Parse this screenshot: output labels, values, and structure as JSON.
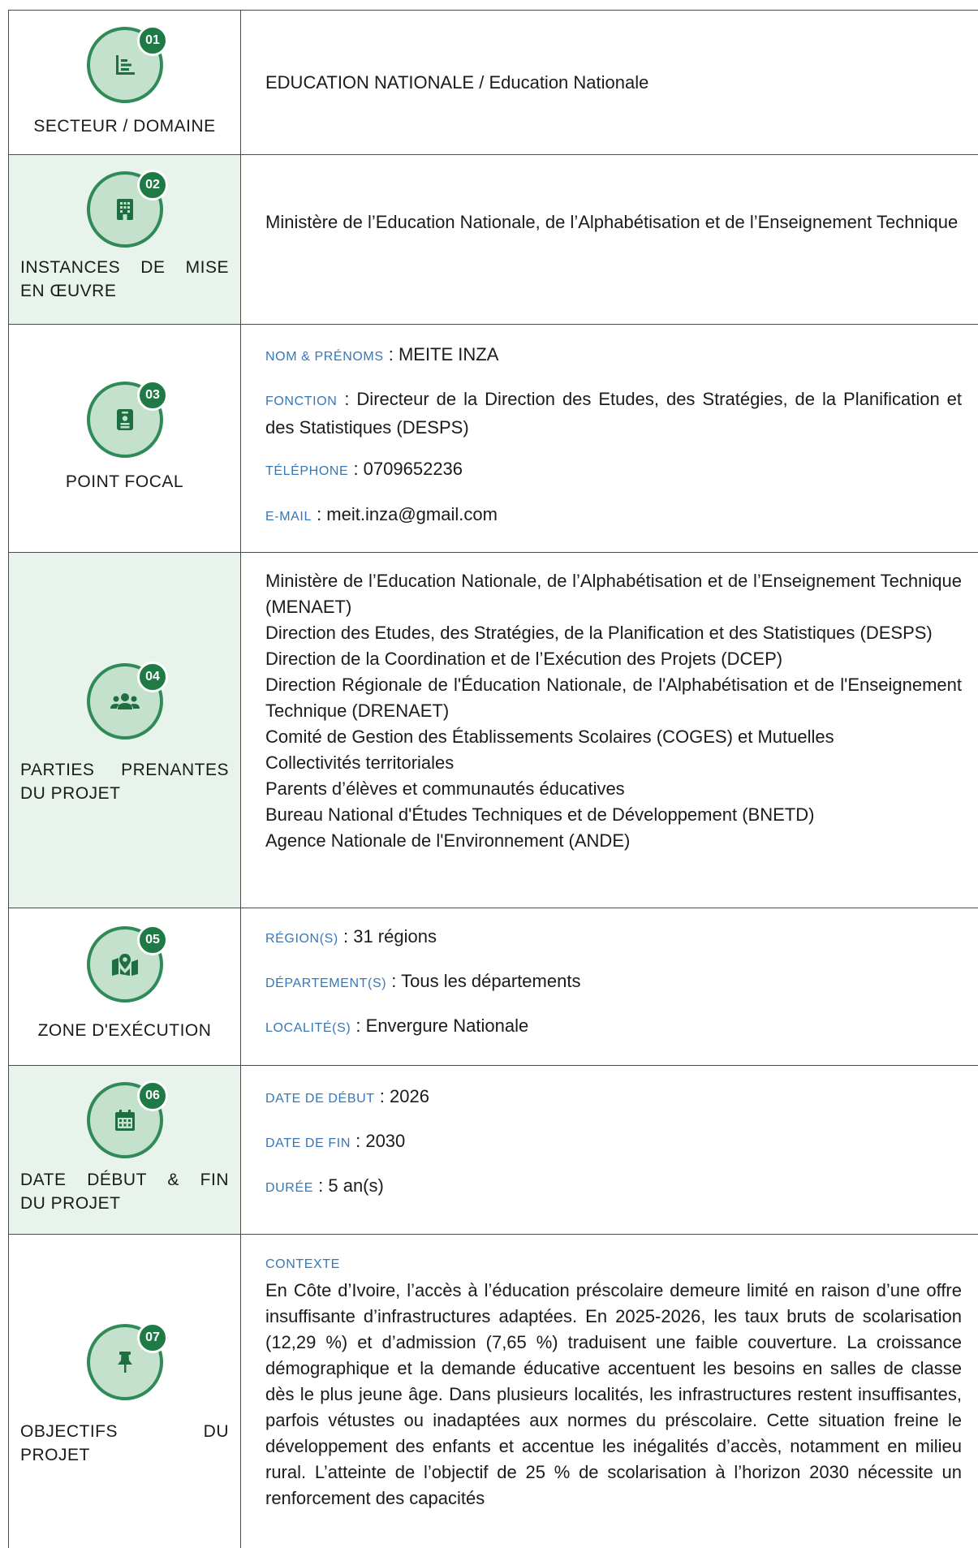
{
  "rows": [
    {
      "number": "01",
      "icon": "list-chart-icon",
      "label": "SECTEUR / DOMAINE",
      "value": "EDUCATION NATIONALE / Education Nationale"
    },
    {
      "number": "02",
      "icon": "building-icon",
      "label_line1": "INSTANCES DE MISE",
      "label_line2": "EN ŒUVRE",
      "value": "Ministère de l’Education Nationale, de l’Alphabétisation et de l’Enseignement Technique"
    },
    {
      "number": "03",
      "icon": "id-badge-icon",
      "label": "POINT FOCAL",
      "fields": [
        {
          "key": "NOM & PRÉNOMS",
          "value": "MEITE INZA"
        },
        {
          "key": "FONCTION",
          "value": "Directeur de la Direction des Etudes, des Stratégies, de la Planification et des Statistiques (DESPS)"
        },
        {
          "key": "TÉLÉPHONE",
          "value": "0709652236"
        },
        {
          "key": "E-MAIL",
          "value": "meit.inza@gmail.com"
        }
      ]
    },
    {
      "number": "04",
      "icon": "users-icon",
      "label_line1": "PARTIES PRENANTES",
      "label_line2": "DU PROJET",
      "stakeholders": [
        "Ministère de l’Education Nationale, de l’Alphabétisation et de l’Enseignement Technique (MENAET)",
        "Direction des Etudes, des Stratégies, de la Planification et des Statistiques (DESPS)",
        "Direction de la Coordination et de l’Exécution des Projets (DCEP)",
        "Direction Régionale de l'Éducation Nationale, de l'Alphabétisation et de l'Enseignement Technique (DRENAET)",
        "Comité de Gestion des Établissements Scolaires (COGES) et Mutuelles",
        "Collectivités territoriales",
        "Parents d’élèves et communautés éducatives",
        "Bureau National d'Études Techniques et de Développement (BNETD)",
        "Agence Nationale de l'Environnement (ANDE)"
      ]
    },
    {
      "number": "05",
      "icon": "map-pin-icon",
      "label": "ZONE D'EXÉCUTION",
      "fields": [
        {
          "key": "RÉGION(S)",
          "value": "31 régions"
        },
        {
          "key": "DÉPARTEMENT(S)",
          "value": "Tous les départements"
        },
        {
          "key": "LOCALITÉ(S)",
          "value": "Envergure Nationale"
        }
      ]
    },
    {
      "number": "06",
      "icon": "calendar-icon",
      "label_line1": "DATE DÉBUT & FIN",
      "label_line2": "DU PROJET",
      "fields": [
        {
          "key": "DATE DE DÉBUT",
          "value": "2026"
        },
        {
          "key": "DATE DE FIN",
          "value": "2030"
        },
        {
          "key": "DURÉE",
          "value": "5 an(s)"
        }
      ]
    },
    {
      "number": "07",
      "icon": "pushpin-icon",
      "label_line1": "OBJECTIFS DU",
      "label_line2": "PROJET",
      "context_key": "CONTEXTE",
      "context_text": "En Côte d’Ivoire, l’accès à l’éducation préscolaire demeure limité en raison d’une offre insuffisante d’infrastructures adaptées. En 2025-2026, les taux bruts de scolarisation (12,29 %) et d’admission (7,65 %) traduisent une faible couverture. La croissance démographique et la demande éducative accentuent les besoins en salles de classe dès le plus jeune âge. Dans plusieurs localités, les infrastructures restent insuffisantes, parfois vétustes ou inadaptées aux normes du préscolaire. Cette situation freine le développement des enfants et accentue les inégalités d’accès, notamment en milieu rural. L’atteinte de l’objectif de 25 % de scolarisation à l’horizon 2030 nécessite un renforcement des capacités"
    }
  ],
  "colors": {
    "accent_green": "#2f8a57",
    "badge_green": "#1f7a45",
    "circle_fill": "#c3e1cd",
    "shaded_cell": "#e8f3ec",
    "key_blue": "#3677b8"
  }
}
